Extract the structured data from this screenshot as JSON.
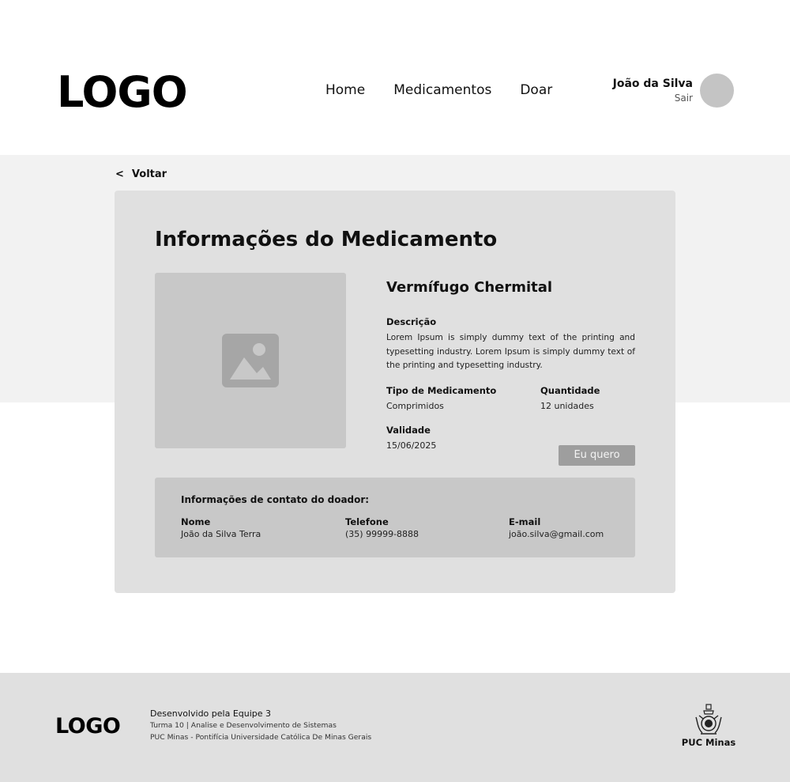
{
  "header": {
    "logo": "LOGO",
    "nav": [
      {
        "label": "Home"
      },
      {
        "label": "Medicamentos"
      },
      {
        "label": "Doar"
      }
    ],
    "user": {
      "name": "João da Silva",
      "logout": "Sair"
    }
  },
  "back": {
    "icon": "<",
    "label": "Voltar"
  },
  "card": {
    "title": "Informações do Medicamento",
    "image_icon": "image-placeholder-icon",
    "medicine": {
      "name": "Vermífugo Chermital",
      "description_label": "Descrição",
      "description": "Lorem Ipsum is simply dummy text of the printing and typesetting industry. Lorem Ipsum is simply dummy text of the printing and typesetting industry.",
      "type_label": "Tipo de Medicamento",
      "type_value": "Comprimidos",
      "quantity_label": "Quantidade",
      "quantity_value": "12 unidades",
      "validity_label": "Validade",
      "validity_value": "15/06/2025"
    },
    "want_button": "Eu quero",
    "contact": {
      "title": "Informações de contato do doador:",
      "name_label": "Nome",
      "name_value": "João da Silva Terra",
      "phone_label": "Telefone",
      "phone_value": "(35) 99999-8888",
      "email_label": "E-mail",
      "email_value": "joão.silva@gmail.com"
    }
  },
  "footer": {
    "logo": "LOGO",
    "line1": "Desenvolvido pela Equipe 3",
    "line2": "Turma 10 | Analise e Desenvolvimento de Sistemas",
    "line3": "PUC Minas - Pontifícia Universidade Católica De Minas Gerais",
    "institution": "PUC Minas"
  },
  "colors": {
    "band": "#f2f2f2",
    "card": "#e0e0e0",
    "placeholder": "#c8c8c8",
    "button": "#9e9e9e",
    "footer": "#e0e0e0"
  }
}
